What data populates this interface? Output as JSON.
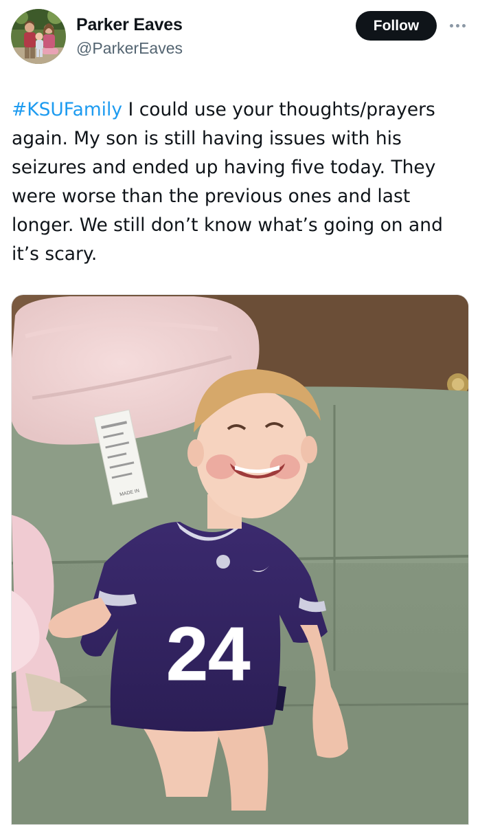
{
  "author": {
    "display_name": "Parker Eaves",
    "handle": "@ParkerEaves",
    "avatar_icon": "profile-photo"
  },
  "actions": {
    "follow_label": "Follow",
    "more_icon": "more-dots-icon"
  },
  "tweet": {
    "hashtag": "#KSUFamily",
    "body": " I could use your thoughts/prayers again. My son is still having issues with his seizures and ended up having five today. They were worse than the previous ones and last longer. We still don’t know what’s going on and it’s scary."
  },
  "media": {
    "jersey_number": "24",
    "tag_text": "MADE IN"
  },
  "colors": {
    "accent": "#1d9bf0",
    "button_bg": "#0f1419",
    "secondary_text": "#536471"
  }
}
